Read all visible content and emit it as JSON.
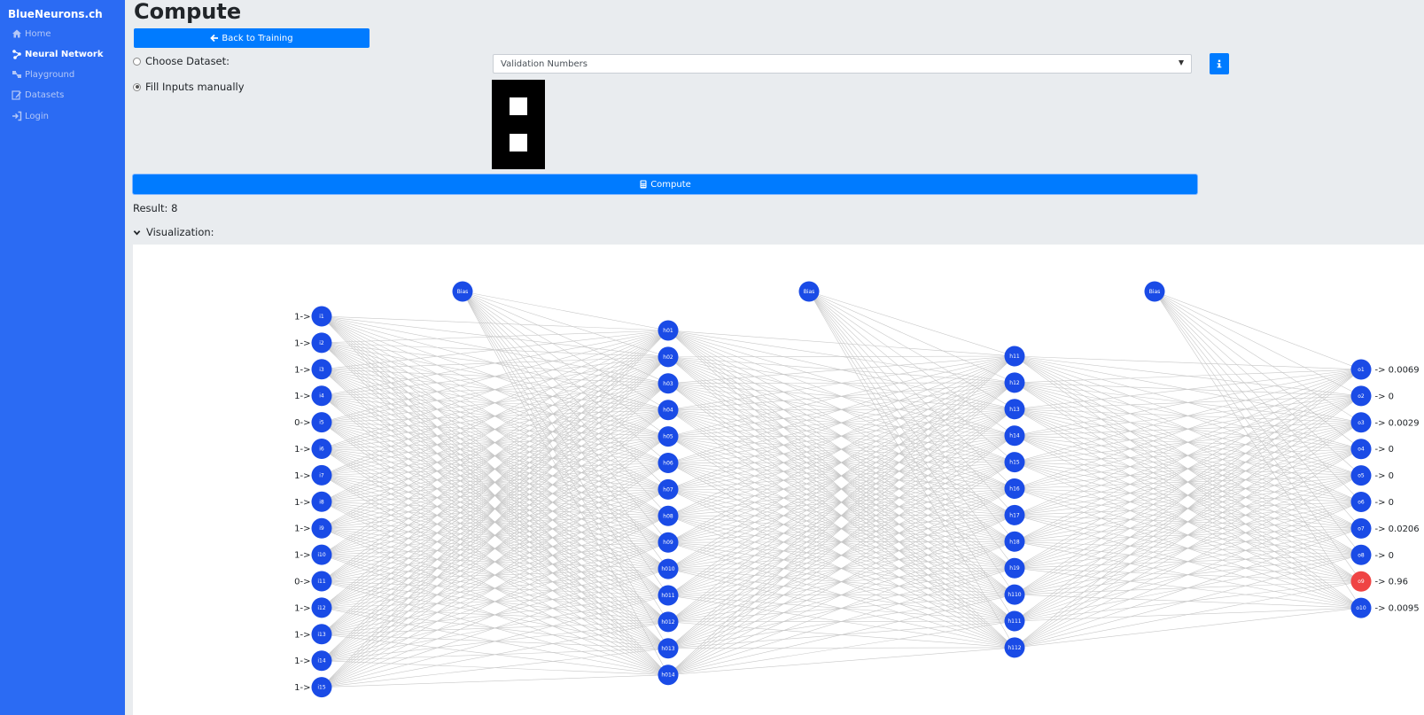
{
  "sidebar": {
    "brand": "BlueNeurons.ch",
    "items": [
      {
        "label": "Home",
        "icon": "home-icon"
      },
      {
        "label": "Neural Network",
        "icon": "network-icon"
      },
      {
        "label": "Playground",
        "icon": "playground-icon"
      },
      {
        "label": "Datasets",
        "icon": "edit-icon"
      },
      {
        "label": "Login",
        "icon": "login-icon"
      }
    ]
  },
  "page": {
    "title": "Compute",
    "back_label": "Back to Training",
    "choose_dataset_label": "Choose Dataset:",
    "fill_manually_label": "Fill Inputs manually",
    "dataset_selected": "Validation Numbers",
    "compute_label": "Compute",
    "result_text": "Result: 8",
    "visualization_label": "Visualization:",
    "colors": {
      "accent": "#007bff",
      "sidebar": "#2b6bf3",
      "node": "#1a4be6",
      "winner": "#ef4444"
    }
  },
  "input_grid": [
    1,
    1,
    1,
    1,
    0,
    1,
    1,
    1,
    1,
    1,
    0,
    1,
    1,
    1,
    1
  ],
  "network": {
    "bias_label": "Bias",
    "inputs": [
      {
        "label": "i1",
        "value": "1->"
      },
      {
        "label": "i2",
        "value": "1->"
      },
      {
        "label": "i3",
        "value": "1->"
      },
      {
        "label": "i4",
        "value": "1->"
      },
      {
        "label": "i5",
        "value": "0->"
      },
      {
        "label": "i6",
        "value": "1->"
      },
      {
        "label": "i7",
        "value": "1->"
      },
      {
        "label": "i8",
        "value": "1->"
      },
      {
        "label": "i9",
        "value": "1->"
      },
      {
        "label": "i10",
        "value": "1->"
      },
      {
        "label": "i11",
        "value": "0->"
      },
      {
        "label": "i12",
        "value": "1->"
      },
      {
        "label": "i13",
        "value": "1->"
      },
      {
        "label": "i14",
        "value": "1->"
      },
      {
        "label": "i15",
        "value": "1->"
      }
    ],
    "hidden1": [
      "h01",
      "h02",
      "h03",
      "h04",
      "h05",
      "h06",
      "h07",
      "h08",
      "h09",
      "h010",
      "h011",
      "h012",
      "h013",
      "h014"
    ],
    "hidden2": [
      "h11",
      "h12",
      "h13",
      "h14",
      "h15",
      "h16",
      "h17",
      "h18",
      "h19",
      "h110",
      "h111",
      "h112"
    ],
    "outputs": [
      {
        "label": "o1",
        "value": "-> 0.0069"
      },
      {
        "label": "o2",
        "value": "-> 0"
      },
      {
        "label": "o3",
        "value": "-> 0.0029"
      },
      {
        "label": "o4",
        "value": "-> 0"
      },
      {
        "label": "o5",
        "value": "-> 0"
      },
      {
        "label": "o6",
        "value": "-> 0"
      },
      {
        "label": "o7",
        "value": "-> 0.0206"
      },
      {
        "label": "o8",
        "value": "-> 0"
      },
      {
        "label": "o9",
        "value": "-> 0.96"
      },
      {
        "label": "o10",
        "value": "-> 0.0095"
      }
    ],
    "winner_index": 8
  }
}
